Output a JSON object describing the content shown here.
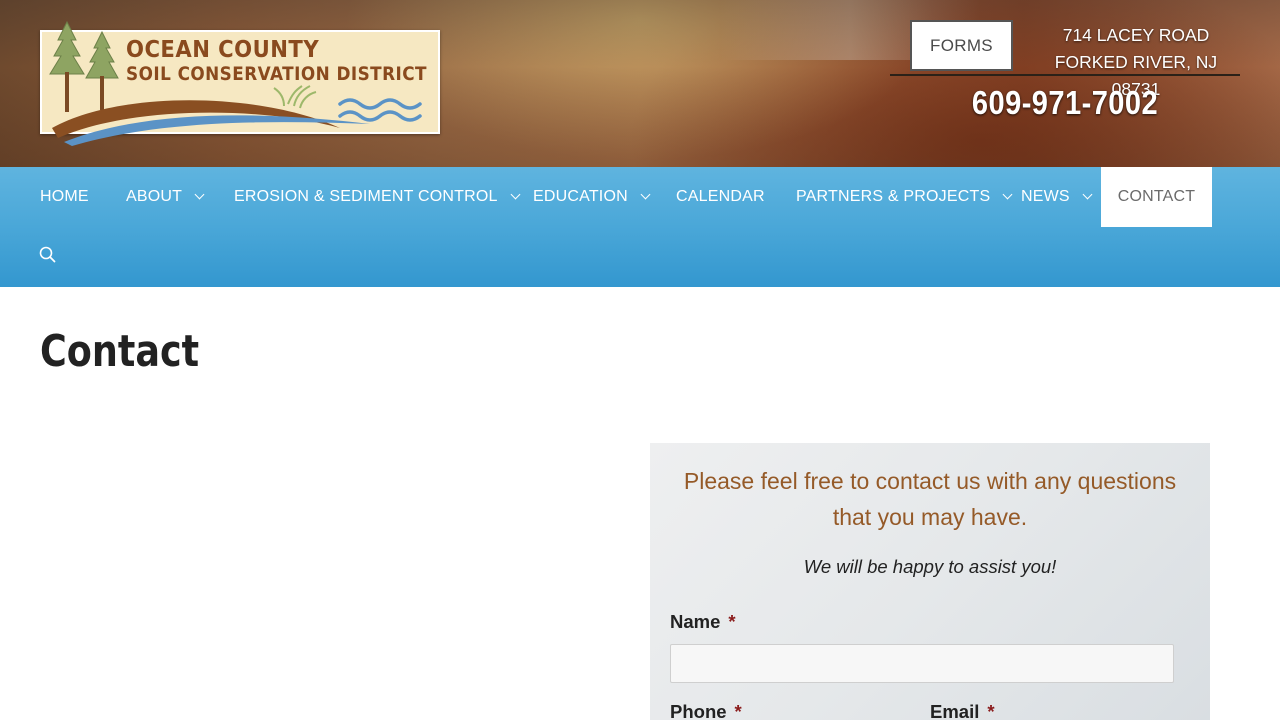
{
  "logo": {
    "line1": "OCEAN COUNTY",
    "line2": "SOIL CONSERVATION DISTRICT"
  },
  "header": {
    "forms_label": "FORMS",
    "address_line1": "714 LACEY ROAD",
    "address_line2": "FORKED RIVER, NJ 08731",
    "phone": "609-971-7002"
  },
  "nav": {
    "items": [
      {
        "label": "HOME"
      },
      {
        "label": "ABOUT"
      },
      {
        "label": "EROSION & SEDIMENT CONTROL"
      },
      {
        "label": "EDUCATION"
      },
      {
        "label": "CALENDAR"
      },
      {
        "label": "PARTNERS & PROJECTS"
      },
      {
        "label": "NEWS"
      },
      {
        "label": "CONTACT"
      }
    ],
    "active": "CONTACT",
    "search_icon": "search-icon"
  },
  "page": {
    "title": "Contact"
  },
  "form": {
    "intro": "Please feel free to contact us with any questions that you may have.",
    "assist": "We will be happy to assist you!",
    "name_label": "Name",
    "phone_label": "Phone",
    "email_label": "Email",
    "required_mark": "*"
  },
  "colors": {
    "nav_blue": "#3f9fd4",
    "intro_brown": "#955a28",
    "required_red": "#8a1a1a"
  }
}
